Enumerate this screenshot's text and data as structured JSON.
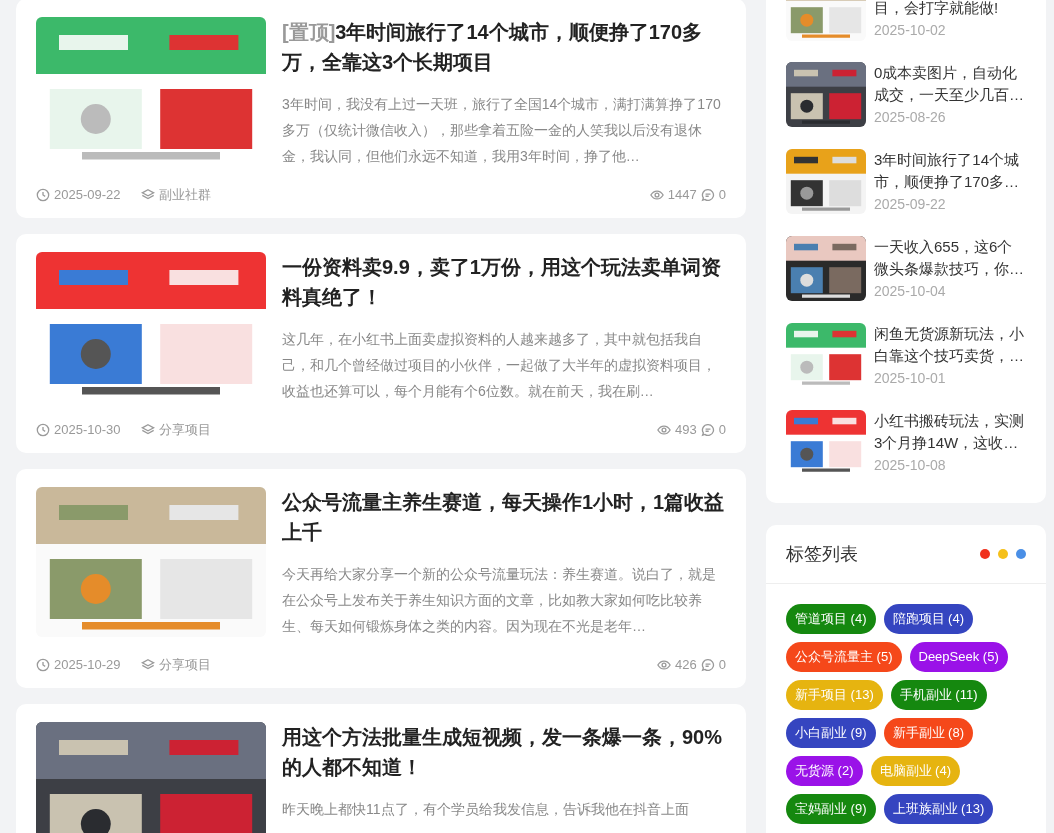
{
  "posts": [
    {
      "pinned_label": "[置顶]",
      "title": "3年时间旅行了14个城市，顺便挣了170多万，全靠这3个长期项目",
      "excerpt": "3年时间，我没有上过一天班，旅行了全国14个城市，满打满算挣了170多万（仅统计微信收入），那些拿着五险一金的人笑我以后没有退休金，我认同，但他们永远不知道，我用3年时间，挣了他…",
      "date": "2025-09-22",
      "category": "副业社群",
      "views": "1447",
      "comments": "0"
    },
    {
      "title": "一份资料卖9.9，卖了1万份，用这个玩法卖单词资料真绝了！",
      "excerpt": "这几年，在小红书上面卖虚拟资料的人越来越多了，其中就包括我自己，和几个曾经做过项目的小伙伴，一起做了大半年的虚拟资料项目，收益也还算可以，每个月能有个6位数。就在前天，我在刷…",
      "date": "2025-10-30",
      "category": "分享项目",
      "views": "493",
      "comments": "0"
    },
    {
      "title": "公众号流量主养生赛道，每天操作1小时，1篇收益上千",
      "excerpt": "今天再给大家分享一个新的公众号流量玩法：养生赛道。说白了，就是在公众号上发布关于养生知识方面的文章，比如教大家如何吃比较养生、每天如何锻炼身体之类的内容。因为现在不光是老年…",
      "date": "2025-10-29",
      "category": "分享项目",
      "views": "426",
      "comments": "0"
    },
    {
      "title": "用这个方法批量生成短视频，发一条爆一条，90%的人都不知道！",
      "excerpt": "昨天晚上都快11点了，有个学员给我发信息，告诉我他在抖音上面"
    }
  ],
  "sidebar": {
    "recent_posts": [
      {
        "title": "目，会打字就能做!",
        "date": "2025-10-02"
      },
      {
        "title": "0成本卖图片，自动化成交，一天至少几百…",
        "date": "2025-08-26"
      },
      {
        "title": "3年时间旅行了14个城市，顺便挣了170多…",
        "date": "2025-09-22"
      },
      {
        "title": "一天收入655，这6个微头条爆款技巧，你…",
        "date": "2025-10-04"
      },
      {
        "title": "闲鱼无货源新玩法，小白靠这个技巧卖货，…",
        "date": "2025-10-01"
      },
      {
        "title": "小红书搬砖玩法，实测3个月挣14W，这收…",
        "date": "2025-10-08"
      }
    ],
    "tags_panel": {
      "title": "标签列表",
      "tags": [
        {
          "label": "管道项目 (4)",
          "color": "#15880f"
        },
        {
          "label": "陪跑项目 (4)",
          "color": "#3545c0"
        },
        {
          "label": "公众号流量主 (5)",
          "color": "#f5481a"
        },
        {
          "label": "DeepSeek (5)",
          "color": "#9a12e8"
        },
        {
          "label": "新手项目 (13)",
          "color": "#e6b410"
        },
        {
          "label": "手机副业 (11)",
          "color": "#15880f"
        },
        {
          "label": "小白副业 (9)",
          "color": "#3545c0"
        },
        {
          "label": "新手副业 (8)",
          "color": "#f5481a"
        },
        {
          "label": "无货源 (2)",
          "color": "#9a12e8"
        },
        {
          "label": "电脑副业 (4)",
          "color": "#e6b410"
        },
        {
          "label": "宝妈副业 (9)",
          "color": "#15880f"
        },
        {
          "label": "上班族副业 (13)",
          "color": "#3545c0"
        }
      ]
    }
  }
}
